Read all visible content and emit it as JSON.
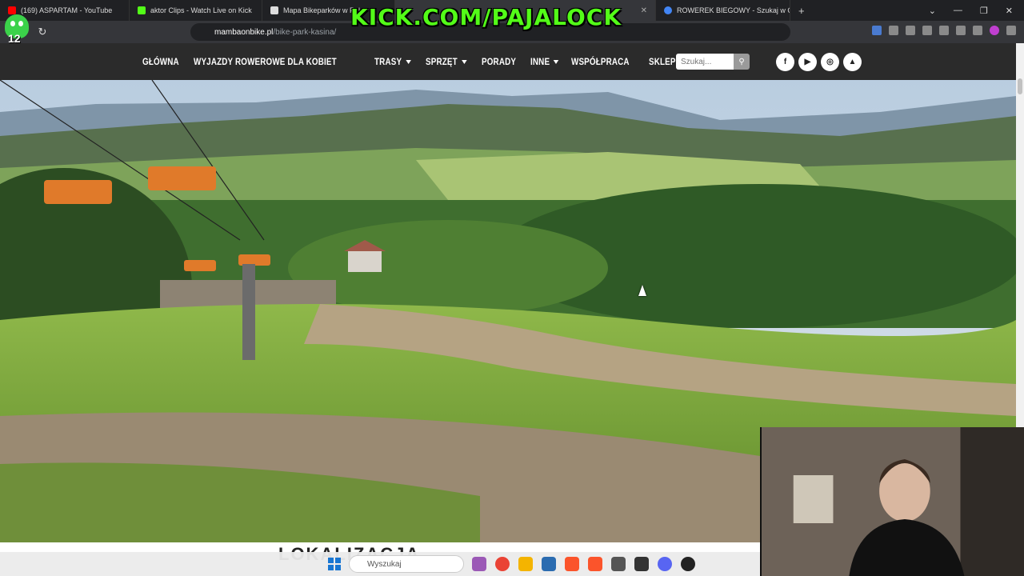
{
  "browser": {
    "tabs": [
      {
        "title": "(169) ASPARTAM - YouTube",
        "color": "#ff0000"
      },
      {
        "title": "aktor Clips - Watch Live on Kick",
        "color": "#53fc18"
      },
      {
        "title": "Mapa Bikeparków w Pol",
        "color": "#ffffff"
      },
      {
        "title": "",
        "color": "#888888"
      },
      {
        "title": "ROWEREK BIEGOWY - Szukaj w Goo",
        "color": "#4285f4"
      }
    ],
    "new_tab_label": "+",
    "url_host": "mambaonbike.pl",
    "url_path": "/bike-park-kasina/"
  },
  "overlay": {
    "stream_text": "KICK.COM/PAJALOCK",
    "badge_number": "12"
  },
  "site": {
    "menu": [
      {
        "label": "GŁÓWNA",
        "dropdown": false
      },
      {
        "label": "WYJAZDY ROWEROWE DLA KOBIET",
        "dropdown": false
      },
      {
        "label": "TRASY",
        "dropdown": true
      },
      {
        "label": "SPRZĘT",
        "dropdown": true
      },
      {
        "label": "PORADY",
        "dropdown": false
      },
      {
        "label": "INNE",
        "dropdown": true
      },
      {
        "label": "WSPÓŁPRACA",
        "dropdown": false
      },
      {
        "label": "SKLEP",
        "dropdown": true
      }
    ],
    "search_placeholder": "Szukaj...",
    "socials": [
      {
        "icon": "facebook-icon",
        "glyph": "f"
      },
      {
        "icon": "youtube-icon",
        "glyph": "▶"
      },
      {
        "icon": "instagram-icon",
        "glyph": "◎"
      },
      {
        "icon": "strava-icon",
        "glyph": "▲"
      }
    ],
    "section_heading": "LOKALIZACJA"
  },
  "taskbar": {
    "search_placeholder": "Wyszukaj",
    "apps": [
      "#9b59b6",
      "#ea4335",
      "#f4b400",
      "#2b6cb0",
      "#fb542b",
      "#fb542b",
      "#555555",
      "#333333",
      "#5865f2",
      "#222222"
    ]
  },
  "colors": {
    "nav_bg": "#2b2b2b",
    "kick_green": "#53fc18"
  }
}
